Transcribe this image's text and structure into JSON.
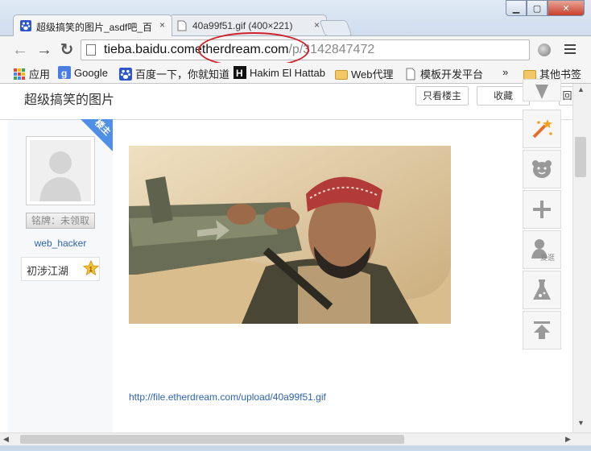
{
  "tabs": [
    {
      "label": "超级搞笑的图片_asdf吧_百",
      "close": "×",
      "icon": "baidu-paw-icon"
    },
    {
      "label": "40a99f51.gif (400×221)",
      "close": "×",
      "icon": "document-icon"
    }
  ],
  "window_controls": {
    "minimize": "▁",
    "maximize": "▢",
    "close": "✕"
  },
  "toolbar": {
    "back": "←",
    "forward": "→",
    "reload": "↻",
    "url_host": "tieba.baidu.com",
    "url_host2": "etherdream.com",
    "url_path": "/p/3142847472"
  },
  "bookmarks": [
    {
      "label": "应用",
      "icon": "apps-grid-icon"
    },
    {
      "label": "Google",
      "icon": "google-icon"
    },
    {
      "label": "百度一下，你就知道",
      "icon": "baidu-paw-icon"
    },
    {
      "label": "Hakim El Hattab",
      "icon": "h-logo-icon"
    },
    {
      "label": "Web代理",
      "icon": "folder-icon"
    },
    {
      "label": "模板开发平台",
      "icon": "document-icon"
    },
    {
      "label": "»",
      "icon": ""
    },
    {
      "label": "其他书签",
      "icon": "folder-icon"
    }
  ],
  "page": {
    "title": "超级搞笑的图片",
    "btn_only_lz": "只看楼主",
    "btn_collect": "收藏",
    "btn_back": "回",
    "lz_tag": "楼主",
    "badge": "铭牌：未领取",
    "username": "web_hacker",
    "level_name": "初涉江湖",
    "level_num": "1",
    "link": "http://file.etherdream.com/upload/40a99f51.gif"
  },
  "right_tools": [
    "play-icon",
    "magic-wand-icon",
    "bear-face-icon",
    "plus-icon",
    "user-love-icon",
    "flask-icon",
    "back-to-top-icon"
  ],
  "right_tool_label": "爱逛",
  "colors": {
    "accent": "#4f8fe6",
    "link": "#2d64b3",
    "annotation": "#d0202a"
  }
}
